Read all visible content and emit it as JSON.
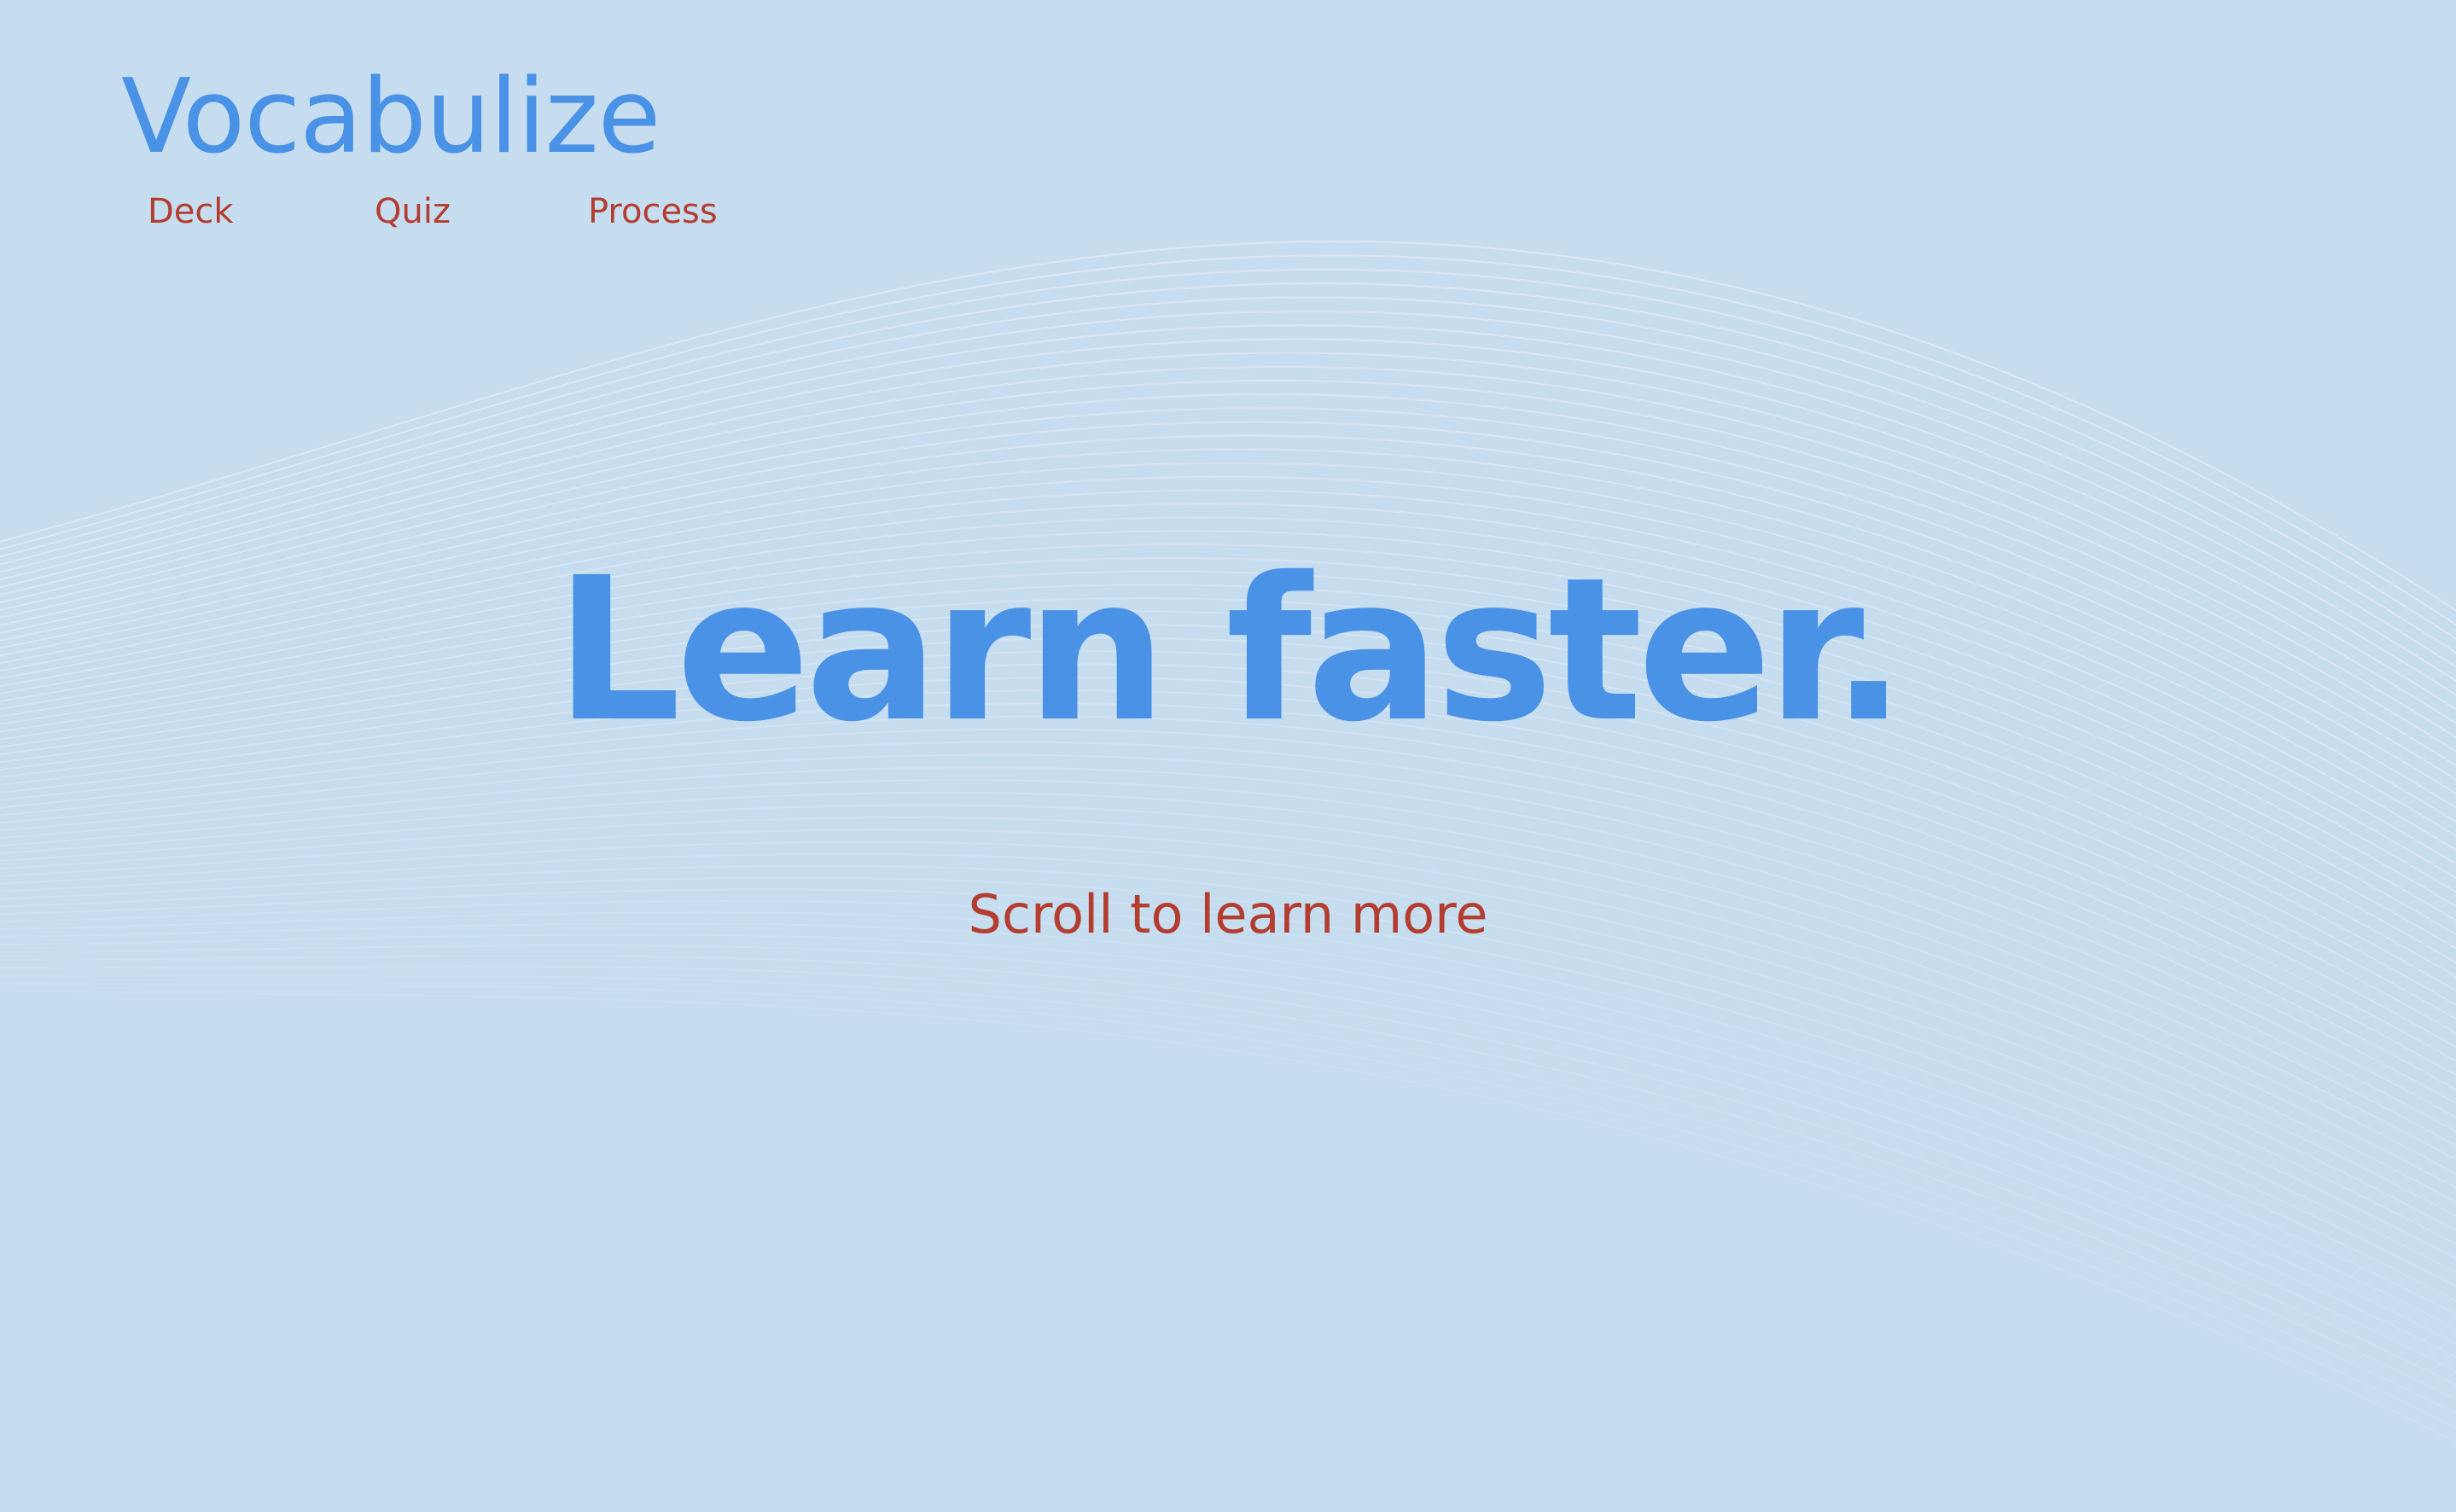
{
  "brand": {
    "name": "Vocabulize"
  },
  "nav": {
    "items": [
      {
        "label": "Deck"
      },
      {
        "label": "Quiz"
      },
      {
        "label": "Process"
      }
    ]
  },
  "hero": {
    "headline": "Learn faster.",
    "cta": "Scroll to learn more"
  },
  "colors": {
    "background": "#c6dcef",
    "brand_blue": "#4a92e6",
    "link_red": "#b33d2f",
    "wave_lines": "#ffffff"
  }
}
